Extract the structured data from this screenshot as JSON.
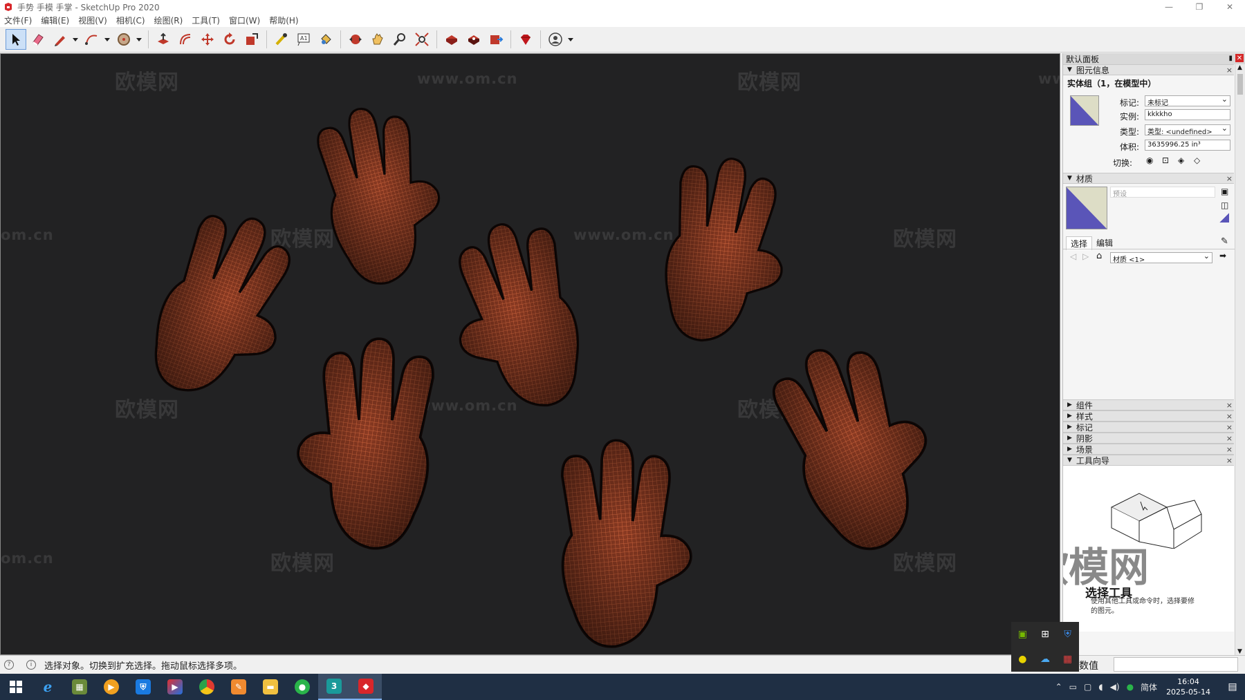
{
  "window": {
    "title": "手势 手模 手掌 - SketchUp Pro 2020",
    "controls": [
      "—",
      "❐",
      "✕"
    ]
  },
  "menu": [
    "文件(F)",
    "编辑(E)",
    "视图(V)",
    "相机(C)",
    "绘图(R)",
    "工具(T)",
    "窗口(W)",
    "帮助(H)"
  ],
  "toolbar": {
    "tools": [
      "select-tool",
      "eraser-tool",
      "line-tool",
      "arc-tool",
      "shape-tool",
      "push-pull-tool",
      "offset-tool",
      "move-tool",
      "rotate-tool",
      "scale-tool",
      "tape-measure-tool",
      "text-tool",
      "paint-bucket-tool",
      "orbit-tool",
      "pan-tool",
      "zoom-tool",
      "zoom-extents-tool",
      "warehouse-tool",
      "extension-warehouse-tool",
      "send-to-layout-tool",
      "ruby-tool",
      "account-tool"
    ]
  },
  "viewport": {
    "background": "#222223",
    "watermarks": {
      "brand": "欧模网",
      "url": "www.om.cn",
      "url_short": "om.cn"
    },
    "model_color": "#a04a2c",
    "model_wire": "#e07a4c",
    "hand_count": 7
  },
  "tray": {
    "title": "默认面板",
    "entity_info": {
      "header": "图元信息",
      "selection": "实体组（1，在模型中）",
      "tag_label": "标记:",
      "tag_value": "未标记",
      "instance_label": "实例:",
      "instance_value": "kkkkho",
      "type_label": "类型:",
      "type_value": "类型: <undefined>",
      "volume_label": "体积:",
      "volume_value": "3635996.25 in³",
      "toggle_label": "切换:"
    },
    "materials": {
      "header": "材质",
      "name_placeholder": "预设",
      "tab_select": "选择",
      "tab_edit": "编辑",
      "library": "材质 <1>",
      "swatch_color": "#5a55b8",
      "swatch_bg": "#ddddc6"
    },
    "collapsed_panels": [
      "组件",
      "样式",
      "标记",
      "阴影",
      "场景"
    ],
    "instructor": {
      "header": "工具向导",
      "tool_name": "选择工具",
      "desc_line1": "使用其他工具或命令时，选择要修",
      "desc_line2": "的图元。"
    }
  },
  "status": {
    "message": "选择对象。切换到扩充选择。拖动鼠标选择多项。",
    "measure_label": "数值",
    "measure_value": ""
  },
  "taskbar": {
    "apps": [
      "start",
      "ie",
      "minecraft",
      "media",
      "shield",
      "store",
      "chrome",
      "notes",
      "explorer",
      "wechat",
      "3dsmax",
      "sketchup"
    ],
    "ime": "简体",
    "time": "16:04",
    "date": "2025-05-14"
  }
}
